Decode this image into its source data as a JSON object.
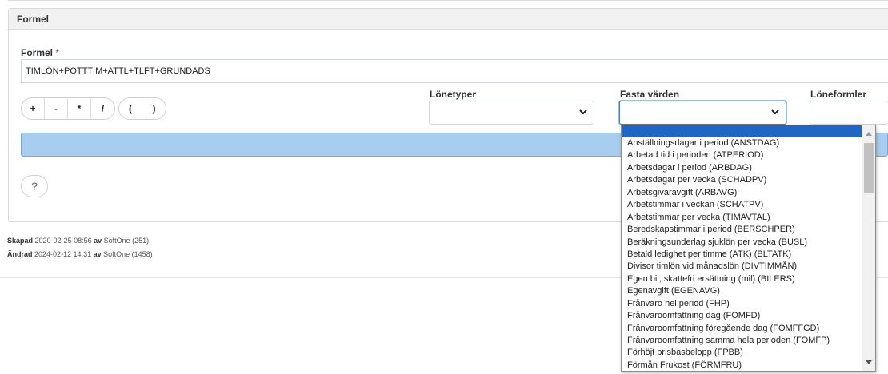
{
  "panel": {
    "title": "Formel"
  },
  "formula": {
    "label": "Formel",
    "required_marker": "*",
    "value": "TIMLÖN+POTTTIM+ATTL+TLFT+GRUNDADS"
  },
  "operators": {
    "group1": [
      "+",
      "-",
      "*",
      "/"
    ],
    "group2": [
      "(",
      ")"
    ]
  },
  "selects": {
    "lonetyper": {
      "label": "Lönetyper",
      "value": ""
    },
    "fasta_varden": {
      "label": "Fasta värden",
      "value": ""
    },
    "loneformler": {
      "label": "Löneformler",
      "value": ""
    }
  },
  "help": {
    "label": "?"
  },
  "audit": {
    "created_label": "Skapad",
    "created_date": "2020-02-25 08:56",
    "created_by_word": "av",
    "created_by": "SoftOne (251)",
    "modified_label": "Ändrad",
    "modified_date": "2024-02-12 14:31",
    "modified_by_word": "av",
    "modified_by": "SoftOne (1458)"
  },
  "dropdown": {
    "options": [
      "Anställningsdagar i period (ANSTDAG)",
      "Arbetad tid i perioden (ATPERIOD)",
      "Arbetsdagar i period (ARBDAG)",
      "Arbetsdagar per vecka (SCHADPV)",
      "Arbetsgivaravgift (ARBAVG)",
      "Arbetstimmar i veckan (SCHATPV)",
      "Arbetstimmar per vecka (TIMAVTAL)",
      "Beredskapstimmar i period (BERSCHPER)",
      "Beräkningsunderlag sjuklön per vecka (BUSL)",
      "Betald ledighet per timme (ATK) (BLTATK)",
      "Divisor timlön vid månadslön (DIVTIMMÅN)",
      "Egen bil, skattefri ersättning (mil) (BILERS)",
      "Egenavgift (EGENAVG)",
      "Frånvaro hel period (FHP)",
      "Frånvaroomfattning dag (FOMFD)",
      "Frånvaroomfattning föregående dag (FOMFFGD)",
      "Frånvaroomfattning samma hela perioden (FOMFP)",
      "Förhöjt prisbasbelopp (FPBB)",
      "Förmån Frukost (FÖRMFRU)"
    ]
  },
  "colors": {
    "accent": "#1f66c7",
    "bar": "#a8cdef",
    "required": "#c0392b"
  }
}
